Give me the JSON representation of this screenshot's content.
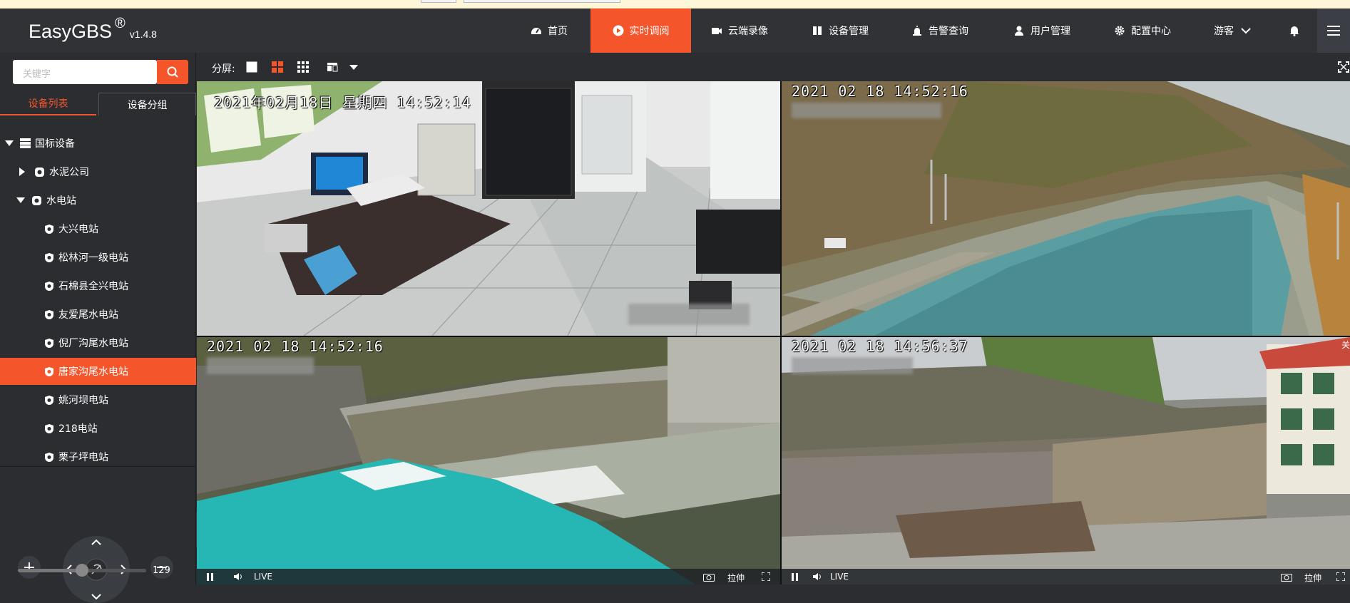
{
  "app": {
    "brand": "EasyGBS",
    "reg": "®",
    "version": "v1.4.8"
  },
  "nav": {
    "items": [
      {
        "label": "首页",
        "icon": "dashboard-icon"
      },
      {
        "label": "实时调阅",
        "icon": "play-circle-icon",
        "active": true
      },
      {
        "label": "云端录像",
        "icon": "video-camera-icon"
      },
      {
        "label": "设备管理",
        "icon": "device-icon"
      },
      {
        "label": "告警查询",
        "icon": "alarm-icon"
      },
      {
        "label": "用户管理",
        "icon": "user-icon"
      },
      {
        "label": "配置中心",
        "icon": "gear-icon"
      }
    ],
    "user": "游客",
    "accent": "#f5552b"
  },
  "sidebar": {
    "search_placeholder": "关键字",
    "tabs": [
      "设备列表",
      "设备分组"
    ],
    "tree": {
      "root": "国标设备",
      "groups": [
        {
          "label": "水泥公司",
          "expanded": false
        },
        {
          "label": "水电站",
          "expanded": true
        }
      ],
      "channels": [
        "大兴电站",
        "松林河一级电站",
        "石棉县全兴电站",
        "友爱尾水电站",
        "倪厂沟尾水电站",
        "唐家沟尾水电站",
        "姚河坝电站",
        "218电站",
        "栗子坪电站"
      ],
      "selected_channel": "唐家沟尾水电站"
    },
    "ptz": {
      "speed": "129",
      "speed_fraction": 0.5
    }
  },
  "toolbar": {
    "split_label": "分屏:"
  },
  "views": [
    {
      "timestamp": "2021年02月18日  星期四  14:52:14",
      "scene": "server-room"
    },
    {
      "timestamp": "2021 02 18  14:52:16",
      "scene": "river-valley"
    },
    {
      "timestamp": "2021 02 18  14:52:16",
      "scene": "dam-outflow"
    },
    {
      "timestamp": "2021 02 18  14:56:37",
      "scene": "concrete-wall"
    }
  ],
  "player": {
    "live_label": "LIVE",
    "stretch_label": "拉伸",
    "close_label": "关"
  }
}
